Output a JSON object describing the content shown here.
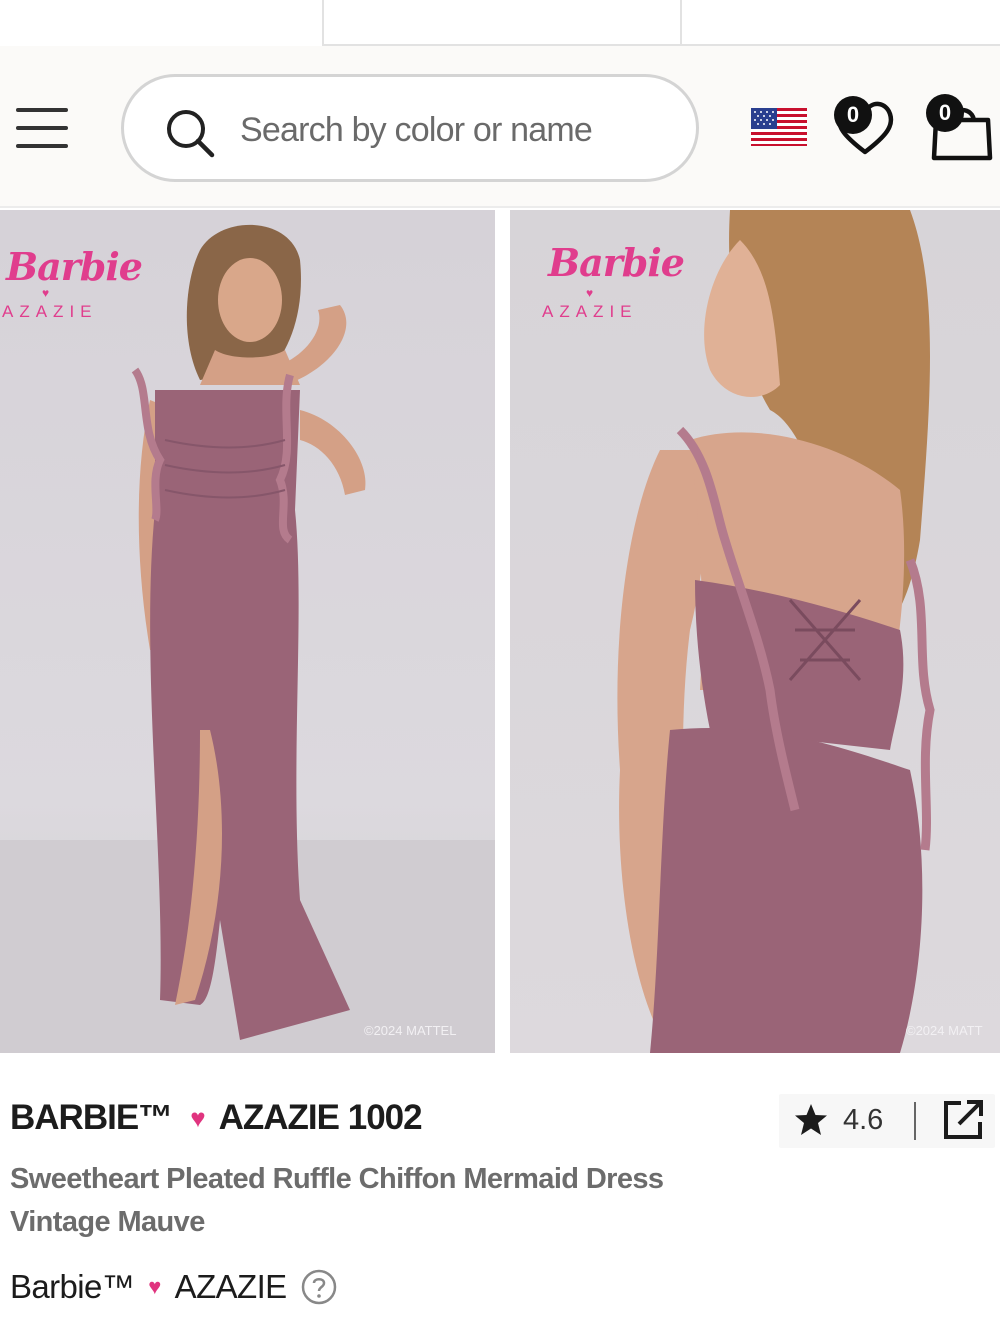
{
  "search": {
    "placeholder": "Search by color or name"
  },
  "header": {
    "flag": "us-flag-icon",
    "wishlist_count": "0",
    "cart_count": "0"
  },
  "images": [
    {
      "brand_script": "Barbie",
      "brand_sub": "AZAZIE",
      "copyright": "©2024 MATTEL"
    },
    {
      "brand_script": "Barbie",
      "brand_sub": "AZAZIE",
      "copyright": "©2024 MATT"
    }
  ],
  "product": {
    "title_left": "BARBIE™",
    "title_right": "AZAZIE 1002",
    "rating": "4.6",
    "name": "Sweetheart Pleated Ruffle Chiffon Mermaid Dress",
    "color": "Vintage Mauve",
    "brand_left": "Barbie™",
    "brand_right": "AZAZIE"
  },
  "colors": {
    "accent": "#e0347f",
    "dress": "#9a6477"
  }
}
